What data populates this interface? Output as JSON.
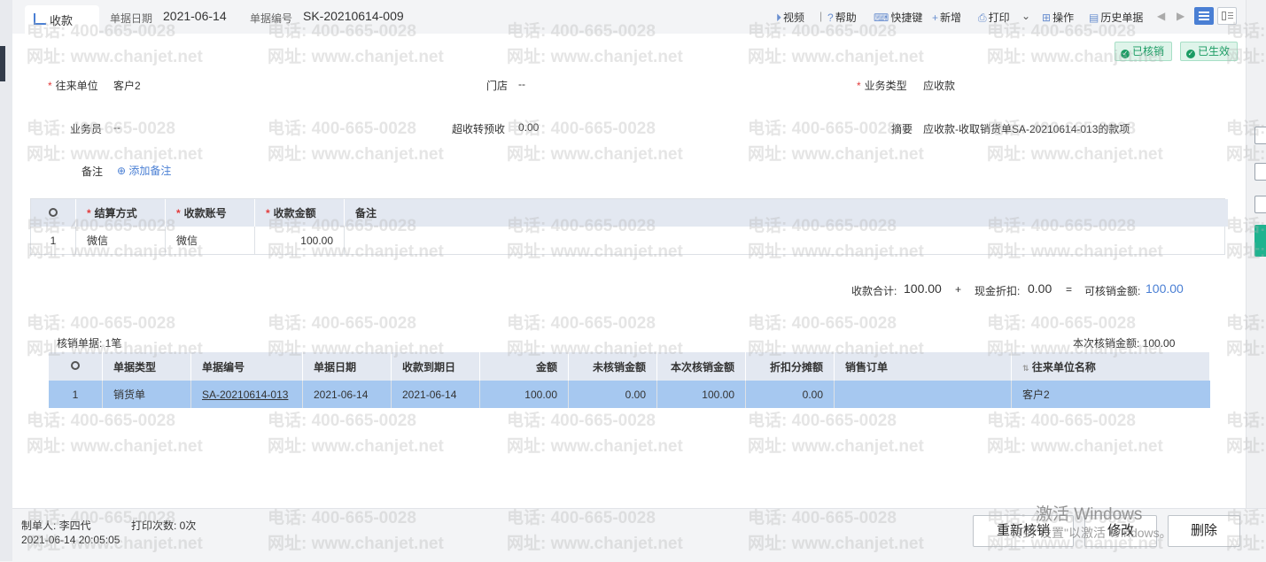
{
  "tab": {
    "label": "收款"
  },
  "header": {
    "date_label": "单据日期",
    "date_value": "2021-06-14",
    "no_label": "单据编号",
    "no_value": "SK-20210614-009"
  },
  "toolbar": {
    "video": "视频",
    "help": "帮助",
    "shortcut": "快捷键",
    "add": "新增",
    "print": "打印",
    "ops": "操作",
    "history": "历史单据"
  },
  "badges": {
    "verified": "已核销",
    "effective": "已生效"
  },
  "form": {
    "partner_label": "往来单位",
    "partner_value": "客户2",
    "store_label": "门店",
    "store_value": "--",
    "biz_type_label": "业务类型",
    "biz_type_value": "应收款",
    "salesman_label": "业务员",
    "salesman_value": "--",
    "over_label": "超收转预收",
    "over_value": "0.00",
    "summary_label": "摘要",
    "summary_value": "应收款-收取销货单SA-20210614-013的款项",
    "remark_label": "备注",
    "remark_add": "添加备注"
  },
  "payment_table": {
    "headers": [
      "结算方式",
      "收款账号",
      "收款金额",
      "备注"
    ],
    "rows": [
      {
        "idx": "1",
        "method": "微信",
        "account": "微信",
        "amount": "100.00",
        "remark": ""
      }
    ]
  },
  "totals": {
    "recv_label": "收款合计:",
    "recv_value": "100.00",
    "plus": "+",
    "disc_label": "现金折扣:",
    "disc_value": "0.00",
    "eq": "=",
    "avail_label": "可核销金额:",
    "avail_value": "100.00"
  },
  "verify": {
    "count_text": "核销单据: 1笔",
    "this_text": "本次核销金额: 100.00",
    "headers": [
      "单据类型",
      "单据编号",
      "单据日期",
      "收款到期日",
      "金额",
      "未核销金额",
      "本次核销金额",
      "折扣分摊额",
      "销售订单",
      "往来单位名称"
    ],
    "rows": [
      {
        "idx": "1",
        "type": "销货单",
        "no": "SA-20210614-013",
        "date": "2021-06-14",
        "due": "2021-06-14",
        "amount": "100.00",
        "unverified": "0.00",
        "this": "100.00",
        "discount": "0.00",
        "order": "",
        "partner": "客户2"
      }
    ]
  },
  "footer": {
    "maker": "制单人: 李四代",
    "print_count": "打印次数: 0次",
    "timestamp": "2021-06-14 20:05:05",
    "btn_reverify": "重新核销",
    "btn_edit": "修改",
    "btn_delete": "删除"
  },
  "watermark": {
    "phone": "电话: 400-665-0028",
    "web": "网址: www.chanjet.net"
  },
  "windows": {
    "line1": "激活 Windows",
    "line2": "转到\"设置\"以激活 Windows。"
  },
  "colors": {
    "accent": "#4a7fd4",
    "badge_green": "#1a9b63",
    "selected_row": "#a6c8f0",
    "side_active": "#1fb38f"
  }
}
